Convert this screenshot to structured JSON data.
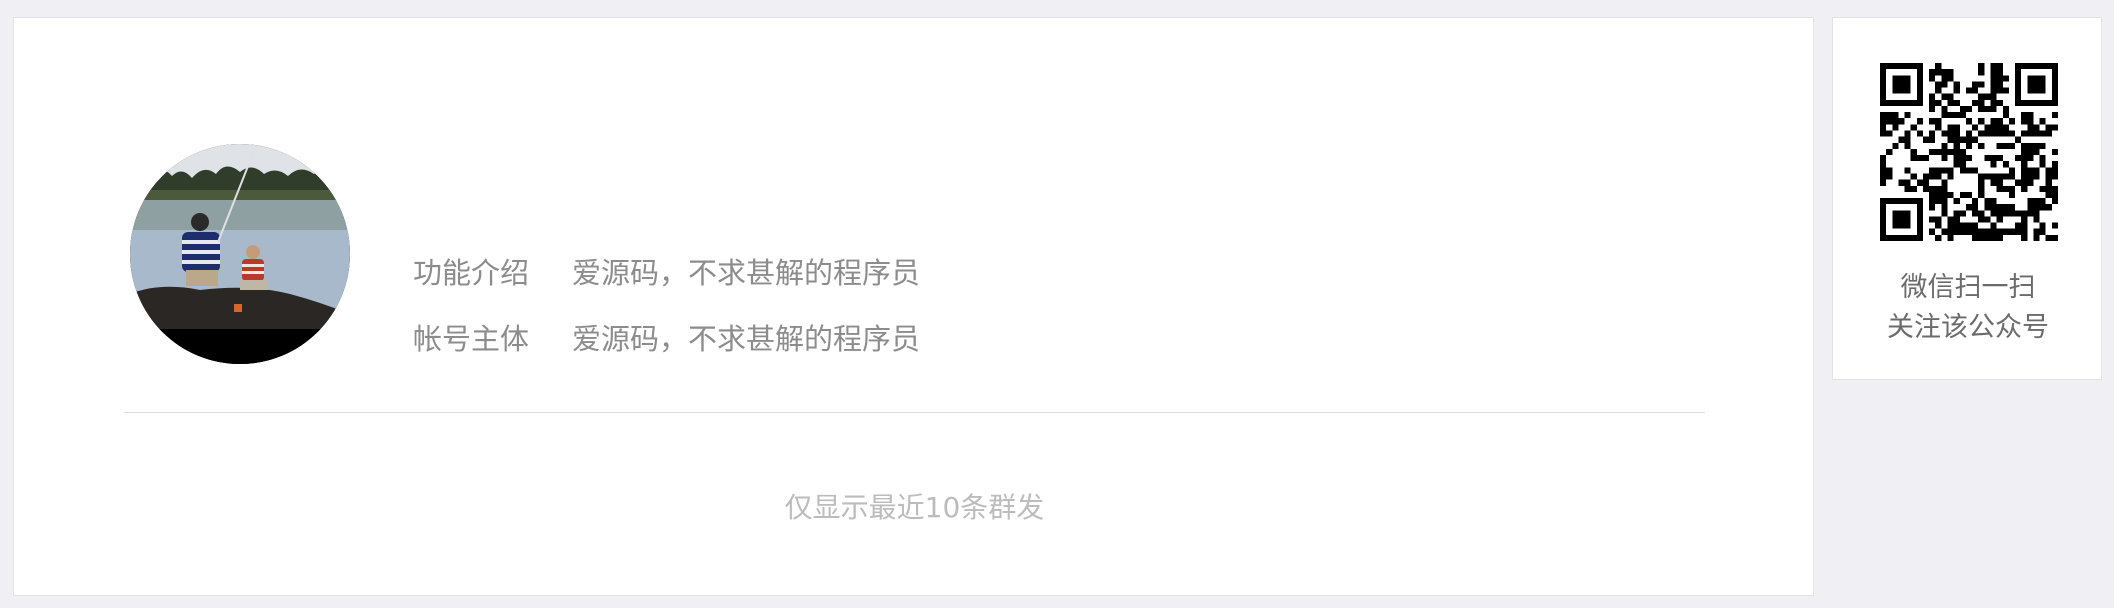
{
  "profile": {
    "avatar_alt": "avatar-photo",
    "fields": [
      {
        "label": "功能介绍",
        "value": "爱源码，不求甚解的程序员"
      },
      {
        "label": "帐号主体",
        "value": "爱源码，不求甚解的程序员"
      }
    ]
  },
  "notice": {
    "text": "仅显示最近10条群发"
  },
  "qr": {
    "icon": "qr-code-icon",
    "caption_line1": "微信扫一扫",
    "caption_line2": "关注该公众号"
  },
  "colors": {
    "page_bg": "#efeff4",
    "card_bg": "#ffffff",
    "label_text": "#8c8c8c",
    "notice_text": "#bcbcbc"
  }
}
